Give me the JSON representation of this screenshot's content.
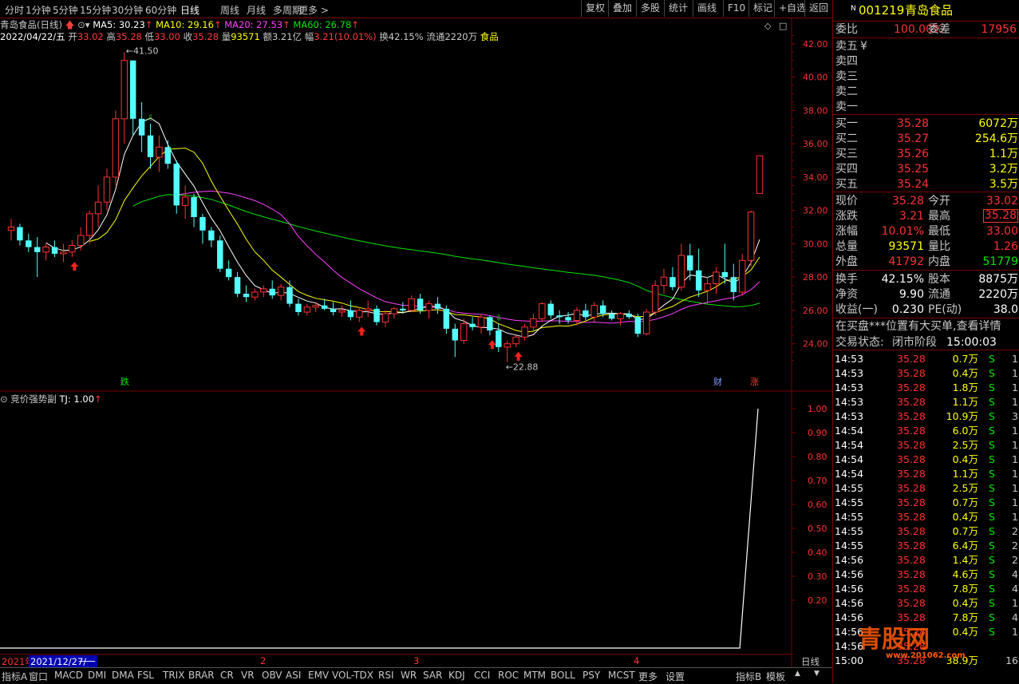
{
  "topbar": {
    "periods": [
      "分时",
      "1分钟",
      "5分钟",
      "15分钟",
      "30分钟",
      "60分钟",
      "日线",
      "周线",
      "月线",
      "多周期",
      "更多 >"
    ],
    "active": "日线",
    "tools": [
      "复权",
      "叠加",
      "多股",
      "统计",
      "画线",
      "F10",
      "标记",
      "+自选",
      "返回"
    ]
  },
  "info": {
    "stock": "青岛食品(日线)",
    "ma5": "MA5: 30.23",
    "ma10": "MA10: 29.16",
    "ma20": "MA20: 27.53",
    "ma60": "MA60: 26.78",
    "date": "2022/04/22/五",
    "open_label": "开",
    "open": "33.02",
    "high_label": "高",
    "high": "35.28",
    "low_label": "低",
    "low": "33.00",
    "close_label": "收",
    "close": "35.28",
    "vol_label": "量",
    "vol": "93571",
    "amount_label": "额",
    "amount": "3.21亿",
    "chg_label": "幅",
    "chg": "3.21(10.01%)",
    "turnover": "换42.15%",
    "float": "流通2220万",
    "sector": "食品"
  },
  "price_axis": [
    "42.00",
    "40.00",
    "38.00",
    "36.00",
    "34.00",
    "32.00",
    "30.00",
    "28.00",
    "26.00",
    "24.00"
  ],
  "annotations": {
    "high": "41.50",
    "low": "22.88",
    "tag_die": "跌",
    "tag_cai": "财",
    "tag_zhang": "涨"
  },
  "indicator": {
    "name": "竞价强势副",
    "tj": "TJ: 1.00",
    "axis": [
      "1.00",
      "0.90",
      "0.80",
      "0.70",
      "0.60",
      "0.50",
      "0.40",
      "0.30",
      "0.20"
    ]
  },
  "date_axis": {
    "start": "2021/12/27/一",
    "prev": "2021年",
    "months": [
      "2",
      "3",
      "4"
    ],
    "right": "日线"
  },
  "bottombar": [
    "指标A",
    "窗口",
    "MACD",
    "DMI",
    "DMA",
    "FSL",
    "TRIX",
    "BRAR",
    "CR",
    "VR",
    "OBV",
    "ASI",
    "EMV",
    "VOL-TDX",
    "RSI",
    "WR",
    "SAR",
    "KDJ",
    "CCI",
    "ROC",
    "MTM",
    "BOLL",
    "PSY",
    "MCST",
    "更多",
    "设置"
  ],
  "bottom_right": [
    "指标B",
    "模板"
  ],
  "panel": {
    "code": "001219",
    "name": "青岛食品",
    "weibi_label": "委比",
    "weibi": "100.00%",
    "weicha_label": "委差",
    "weicha": "17956",
    "sell": [
      {
        "label": "卖五",
        "price": "",
        "vol": "",
        "mark": "¥"
      },
      {
        "label": "卖四",
        "price": "",
        "vol": ""
      },
      {
        "label": "卖三",
        "price": "",
        "vol": ""
      },
      {
        "label": "卖二",
        "price": "",
        "vol": ""
      },
      {
        "label": "卖一",
        "price": "",
        "vol": ""
      }
    ],
    "buy": [
      {
        "label": "买一",
        "price": "35.28",
        "vol": "6072万"
      },
      {
        "label": "买二",
        "price": "35.27",
        "vol": "254.6万"
      },
      {
        "label": "买三",
        "price": "35.26",
        "vol": "1.1万"
      },
      {
        "label": "买四",
        "price": "35.25",
        "vol": "3.2万"
      },
      {
        "label": "买五",
        "price": "35.24",
        "vol": "3.5万"
      }
    ],
    "stats": [
      {
        "l1": "现价",
        "v1": "35.28",
        "l2": "今开",
        "v2": "33.02",
        "c1": "red",
        "c2": "red"
      },
      {
        "l1": "涨跌",
        "v1": "3.21",
        "l2": "最高",
        "v2": "35.28",
        "c1": "red",
        "c2": "red"
      },
      {
        "l1": "涨幅",
        "v1": "10.01%",
        "l2": "最低",
        "v2": "33.00",
        "c1": "red",
        "c2": "red"
      },
      {
        "l1": "总量",
        "v1": "93571",
        "l2": "量比",
        "v2": "1.26",
        "c1": "yellow",
        "c2": "red"
      },
      {
        "l1": "外盘",
        "v1": "41792",
        "l2": "内盘",
        "v2": "51779",
        "c1": "red",
        "c2": "green"
      }
    ],
    "stats2": [
      {
        "l1": "换手",
        "v1": "42.15%",
        "l2": "股本",
        "v2": "8875万"
      },
      {
        "l1": "净资",
        "v1": "9.90",
        "l2": "流通",
        "v2": "2220万"
      },
      {
        "l1": "收益(一)",
        "v1": "0.230",
        "l2": "PE(动)",
        "v2": "38.0"
      }
    ],
    "notice": "在买盘***位置有大买单,查看详情",
    "status_label": "交易状态:",
    "status": "闭市阶段",
    "status_time": "15:00:03",
    "ticks": [
      [
        "14:53",
        "35.28",
        "0.7万",
        "S",
        "1"
      ],
      [
        "14:53",
        "35.28",
        "0.4万",
        "S",
        "1"
      ],
      [
        "14:53",
        "35.28",
        "1.8万",
        "S",
        "1"
      ],
      [
        "14:53",
        "35.28",
        "1.1万",
        "S",
        "1"
      ],
      [
        "14:53",
        "35.28",
        "10.9万",
        "S",
        "3"
      ],
      [
        "14:54",
        "35.28",
        "6.0万",
        "S",
        "1"
      ],
      [
        "14:54",
        "35.28",
        "2.5万",
        "S",
        "1"
      ],
      [
        "14:54",
        "35.28",
        "0.4万",
        "S",
        "1"
      ],
      [
        "14:54",
        "35.28",
        "1.1万",
        "S",
        "1"
      ],
      [
        "14:55",
        "35.28",
        "2.5万",
        "S",
        "1"
      ],
      [
        "14:55",
        "35.28",
        "0.7万",
        "S",
        "1"
      ],
      [
        "14:55",
        "35.28",
        "0.4万",
        "S",
        "1"
      ],
      [
        "14:55",
        "35.28",
        "0.7万",
        "S",
        "2"
      ],
      [
        "14:55",
        "35.28",
        "6.4万",
        "S",
        "2"
      ],
      [
        "14:56",
        "35.28",
        "1.4万",
        "S",
        "2"
      ],
      [
        "14:56",
        "35.28",
        "4.6万",
        "S",
        "4"
      ],
      [
        "14:56",
        "35.28",
        "7.8万",
        "S",
        "4"
      ],
      [
        "14:56",
        "35.28",
        "0.4万",
        "S",
        "1"
      ],
      [
        "14:56",
        "35.28",
        "7.8万",
        "S",
        "4"
      ],
      [
        "14:56",
        "35.28",
        "0.4万",
        "S",
        "1"
      ],
      [
        "14:56",
        "35.28",
        "",
        "",
        ""
      ],
      [
        "15:00",
        "35.28",
        "38.9万",
        "",
        "16"
      ]
    ]
  },
  "watermark": {
    "logo": "青股网",
    "url": "www.201062.com"
  },
  "colors": {
    "up": "#ff3232",
    "down": "#54ffff",
    "ma5": "#ffffff",
    "ma10": "#ffff00",
    "ma20": "#ff40ff",
    "ma60": "#00e600",
    "grid": "#7a0000"
  },
  "chart_data": {
    "type": "candlestick",
    "ylim": [
      22.5,
      43
    ],
    "candles": [
      [
        30.8,
        31.5,
        30.2,
        31.0
      ],
      [
        31.0,
        31.2,
        29.9,
        30.2
      ],
      [
        30.2,
        30.6,
        29.5,
        29.8
      ],
      [
        29.8,
        30.4,
        28.0,
        29.5
      ],
      [
        29.5,
        30.0,
        29.0,
        29.8
      ],
      [
        29.8,
        30.2,
        29.2,
        29.4
      ],
      [
        29.4,
        30.0,
        28.9,
        29.5
      ],
      [
        29.5,
        30.2,
        29.2,
        29.9
      ],
      [
        29.9,
        31.0,
        29.6,
        30.5
      ],
      [
        30.5,
        32.0,
        30.0,
        31.8
      ],
      [
        31.8,
        33.5,
        31.0,
        32.5
      ],
      [
        32.5,
        34.5,
        32.0,
        34.0
      ],
      [
        34.0,
        38.0,
        33.5,
        37.5
      ],
      [
        37.5,
        41.5,
        36.0,
        41.0
      ],
      [
        41.0,
        41.0,
        36.5,
        37.5
      ],
      [
        37.5,
        38.5,
        35.5,
        36.5
      ],
      [
        36.5,
        37.2,
        34.5,
        35.2
      ],
      [
        35.2,
        36.5,
        34.3,
        35.8
      ],
      [
        35.8,
        36.2,
        34.5,
        34.8
      ],
      [
        34.8,
        35.0,
        31.8,
        32.3
      ],
      [
        32.3,
        33.5,
        31.5,
        32.8
      ],
      [
        32.8,
        33.0,
        31.0,
        31.6
      ],
      [
        31.6,
        31.8,
        30.0,
        30.8
      ],
      [
        30.8,
        31.0,
        29.8,
        30.2
      ],
      [
        30.2,
        30.5,
        28.3,
        28.5
      ],
      [
        28.5,
        29.0,
        27.8,
        28.0
      ],
      [
        28.0,
        28.3,
        26.8,
        27.0
      ],
      [
        27.0,
        27.5,
        26.5,
        26.8
      ],
      [
        26.8,
        27.3,
        26.6,
        27.1
      ],
      [
        27.1,
        27.5,
        26.8,
        27.3
      ],
      [
        27.3,
        27.8,
        26.7,
        26.9
      ],
      [
        26.9,
        27.6,
        26.6,
        27.4
      ],
      [
        27.4,
        27.8,
        26.2,
        26.4
      ],
      [
        26.4,
        26.7,
        25.7,
        25.9
      ],
      [
        25.9,
        26.4,
        25.7,
        26.2
      ],
      [
        26.2,
        26.5,
        25.9,
        26.3
      ],
      [
        26.3,
        26.7,
        26.0,
        26.1
      ],
      [
        26.1,
        26.5,
        25.7,
        25.9
      ],
      [
        25.9,
        26.3,
        25.6,
        26.0
      ],
      [
        26.0,
        26.6,
        25.4,
        25.6
      ],
      [
        25.6,
        26.2,
        25.3,
        26.0
      ],
      [
        26.0,
        26.6,
        25.6,
        26.1
      ],
      [
        26.1,
        26.3,
        25.1,
        25.3
      ],
      [
        25.3,
        26.0,
        25.0,
        25.8
      ],
      [
        25.8,
        26.2,
        25.5,
        26.1
      ],
      [
        26.1,
        26.5,
        25.8,
        26.0
      ],
      [
        26.0,
        26.9,
        25.9,
        26.7
      ],
      [
        26.7,
        27.0,
        25.8,
        26.0
      ],
      [
        26.0,
        26.6,
        25.5,
        26.4
      ],
      [
        26.4,
        26.8,
        25.8,
        26.1
      ],
      [
        26.1,
        26.3,
        24.6,
        24.9
      ],
      [
        24.9,
        25.2,
        23.2,
        24.2
      ],
      [
        24.2,
        25.5,
        24.0,
        25.2
      ],
      [
        25.2,
        25.6,
        24.8,
        25.0
      ],
      [
        25.0,
        25.8,
        24.6,
        25.6
      ],
      [
        25.6,
        25.7,
        24.5,
        24.8
      ],
      [
        24.8,
        25.2,
        23.5,
        23.8
      ],
      [
        23.8,
        24.2,
        22.9,
        24.0
      ],
      [
        24.0,
        24.5,
        23.8,
        24.4
      ],
      [
        24.4,
        25.2,
        24.2,
        25.0
      ],
      [
        25.0,
        25.8,
        24.8,
        25.5
      ],
      [
        25.5,
        26.5,
        25.3,
        26.4
      ],
      [
        26.4,
        26.6,
        25.5,
        25.7
      ],
      [
        25.7,
        26.0,
        25.2,
        25.6
      ],
      [
        25.6,
        25.9,
        25.2,
        25.4
      ],
      [
        25.4,
        26.2,
        25.1,
        26.0
      ],
      [
        26.0,
        26.4,
        25.4,
        25.6
      ],
      [
        25.6,
        26.5,
        25.3,
        26.3
      ],
      [
        26.3,
        26.6,
        25.6,
        25.8
      ],
      [
        25.8,
        26.0,
        25.4,
        25.5
      ],
      [
        25.5,
        25.9,
        25.1,
        25.8
      ],
      [
        25.8,
        26.0,
        25.5,
        25.6
      ],
      [
        25.6,
        25.8,
        24.4,
        24.6
      ],
      [
        24.6,
        26.1,
        24.5,
        25.9
      ],
      [
        25.9,
        27.8,
        25.7,
        27.5
      ],
      [
        27.5,
        28.5,
        27.0,
        28.0
      ],
      [
        28.0,
        28.6,
        27.2,
        27.4
      ],
      [
        27.4,
        30.0,
        27.2,
        29.3
      ],
      [
        29.3,
        30.0,
        27.8,
        28.4
      ],
      [
        28.4,
        29.7,
        26.8,
        27.2
      ],
      [
        27.2,
        28.0,
        26.4,
        27.6
      ],
      [
        27.6,
        28.6,
        27.0,
        28.3
      ],
      [
        28.3,
        30.0,
        27.6,
        28.0
      ],
      [
        28.0,
        28.8,
        26.6,
        27.1
      ],
      [
        27.1,
        29.4,
        26.9,
        29.0
      ],
      [
        29.0,
        32.0,
        28.6,
        31.9
      ],
      [
        33.02,
        35.28,
        33.0,
        35.28
      ]
    ]
  }
}
